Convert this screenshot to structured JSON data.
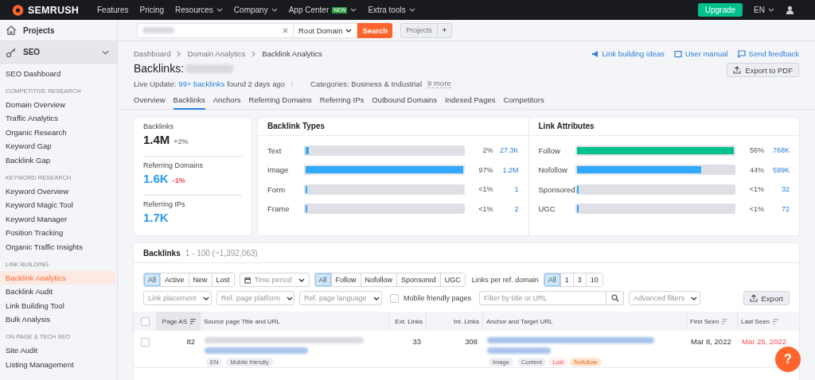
{
  "topnav": {
    "logo": "SEMRUSH",
    "items": [
      {
        "label": "Features",
        "dropdown": false
      },
      {
        "label": "Pricing",
        "dropdown": false
      },
      {
        "label": "Resources",
        "dropdown": true
      },
      {
        "label": "Company",
        "dropdown": true
      },
      {
        "label": "App Center",
        "dropdown": true,
        "badge": "NEW"
      },
      {
        "label": "Extra tools",
        "dropdown": true
      }
    ],
    "upgrade": "Upgrade",
    "language": "EN"
  },
  "sidebar": {
    "projects": "Projects",
    "seo": {
      "label": "SEO",
      "expanded": true
    },
    "sections": [
      {
        "items": [
          {
            "label": "SEO Dashboard",
            "selected": false
          }
        ]
      },
      {
        "heading": "COMPETITIVE RESEARCH",
        "items": [
          {
            "label": "Domain Overview",
            "selected": false
          },
          {
            "label": "Traffic Analytics",
            "selected": false
          },
          {
            "label": "Organic Research",
            "selected": false
          },
          {
            "label": "Keyword Gap",
            "selected": false
          },
          {
            "label": "Backlink Gap",
            "selected": false
          }
        ]
      },
      {
        "heading": "KEYWORD RESEARCH",
        "items": [
          {
            "label": "Keyword Overview",
            "selected": false
          },
          {
            "label": "Keyword Magic Tool",
            "selected": false
          },
          {
            "label": "Keyword Manager",
            "selected": false
          },
          {
            "label": "Position Tracking",
            "selected": false
          },
          {
            "label": "Organic Traffic Insights",
            "selected": false
          }
        ]
      },
      {
        "heading": "LINK BUILDING",
        "items": [
          {
            "label": "Backlink Analytics",
            "selected": true
          },
          {
            "label": "Backlink Audit",
            "selected": false
          },
          {
            "label": "Link Building Tool",
            "selected": false
          },
          {
            "label": "Bulk Analysis",
            "selected": false
          }
        ]
      },
      {
        "heading": "ON PAGE & TECH SEO",
        "items": [
          {
            "label": "Site Audit",
            "selected": false
          },
          {
            "label": "Listing Management",
            "selected": false
          }
        ]
      }
    ]
  },
  "searchbar": {
    "scope": "Root Domain",
    "button": "Search",
    "projects": "Projects",
    "add": "+"
  },
  "breadcrumbs": [
    "Dashboard",
    "Domain Analytics",
    "Backlink Analytics"
  ],
  "title": "Backlinks:",
  "live_update": {
    "label": "Live Update:",
    "link": "99+ backlinks",
    "suffix": "found 2 days ago",
    "categories": "Categories: Business & Industrial",
    "more": "9 more"
  },
  "header_links": [
    "Link building ideas",
    "User manual",
    "Send feedback"
  ],
  "export_pdf": "Export to PDF",
  "tabs": [
    {
      "label": "Overview",
      "selected": false
    },
    {
      "label": "Backlinks",
      "selected": true
    },
    {
      "label": "Anchors",
      "selected": false
    },
    {
      "label": "Referring Domains",
      "selected": false
    },
    {
      "label": "Referring IPs",
      "selected": false
    },
    {
      "label": "Outbound Domains",
      "selected": false
    },
    {
      "label": "Indexed Pages",
      "selected": false
    },
    {
      "label": "Competitors",
      "selected": false
    }
  ],
  "metrics": [
    {
      "label": "Backlinks",
      "value": "1.4M",
      "kind": "plain",
      "change": "+2%",
      "color": "#8a8a8a"
    },
    {
      "label": "Referring Domains",
      "value": "1.6K",
      "kind": "link",
      "change": "-1%",
      "color": "#ff4953"
    },
    {
      "label": "Referring IPs",
      "value": "1.7K",
      "kind": "link"
    }
  ],
  "bar_panels": [
    {
      "title": "Backlink Types",
      "rows": [
        {
          "label": "Text",
          "level": 0.02,
          "color": "#2fa8ff",
          "percent": "2%",
          "count": "27.3K"
        },
        {
          "label": "Image",
          "level": 1,
          "color": "#2fa8ff",
          "percent": "97%",
          "count": "1.2M"
        },
        {
          "label": "Form",
          "level": 0.005,
          "color": "#2fa8ff",
          "percent": "<1%",
          "count": "1"
        },
        {
          "label": "Frame",
          "level": 0.005,
          "color": "#2fa8ff",
          "percent": "<1%",
          "count": "2"
        }
      ]
    },
    {
      "title": "Link Attributes",
      "rows": [
        {
          "label": "Follow",
          "level": 1,
          "color": "#00c08b",
          "percent": "56%",
          "count": "768K"
        },
        {
          "label": "Nofollow",
          "level": 0.79,
          "color": "#2fa8ff",
          "percent": "44%",
          "count": "599K"
        },
        {
          "label": "Sponsored",
          "level": 0.005,
          "color": "#2fa8ff",
          "percent": "<1%",
          "count": "32"
        },
        {
          "label": "UGC",
          "level": 0.005,
          "color": "#2fa8ff",
          "percent": "<1%",
          "count": "72"
        }
      ]
    }
  ],
  "backlinks": {
    "title": "Backlinks",
    "range": "1 - 100 (~1,392,063)",
    "status_filter": [
      {
        "label": "All",
        "selected": true
      },
      {
        "label": "Active",
        "selected": false
      },
      {
        "label": "New",
        "selected": false
      },
      {
        "label": "Lost",
        "selected": false
      }
    ],
    "time_period": "Time period",
    "type_filter": [
      {
        "label": "All",
        "selected": true
      },
      {
        "label": "Follow",
        "selected": false
      },
      {
        "label": "Nofollow",
        "selected": false
      },
      {
        "label": "Sponsored",
        "selected": false
      },
      {
        "label": "UGC",
        "selected": false
      }
    ],
    "per_domain_label": "Links per ref. domain",
    "per_domain": [
      {
        "label": "All",
        "selected": true
      },
      {
        "label": "1",
        "selected": false
      },
      {
        "label": "3",
        "selected": false
      },
      {
        "label": "10",
        "selected": false
      }
    ],
    "dropdowns": [
      "Link placement",
      "Ref. page platform",
      "Ref. page language"
    ],
    "select_all_checked": false,
    "mobile_checkbox": {
      "label": "Mobile friendly pages",
      "checked": false
    },
    "filter_placeholder": "Filter by title or URL",
    "advanced": "Advanced filters",
    "export": "Export",
    "columns": [
      {
        "label": "Page AS",
        "sortable": true,
        "sorted": true
      },
      {
        "label": "Source page Title and URL",
        "sortable": false,
        "sorted": false
      },
      {
        "label": "Ext. Links",
        "sortable": false,
        "sorted": false
      },
      {
        "label": "Int. Links",
        "sortable": false,
        "sorted": false
      },
      {
        "label": "Anchor and Target URL",
        "sortable": false,
        "sorted": false
      },
      {
        "label": "First Seen",
        "sortable": true,
        "sorted": false
      },
      {
        "label": "Last Seen",
        "sortable": true,
        "sorted": false
      }
    ],
    "rows": [
      {
        "checked": false,
        "page_as": "82",
        "source_tags": [
          {
            "label": "EN",
            "kind": "plain"
          },
          {
            "label": "Mobile friendly",
            "kind": "plain"
          }
        ],
        "ext": "33",
        "int": "308",
        "anchor_tags": [
          {
            "label": "Image",
            "kind": "plain"
          },
          {
            "label": "Content",
            "kind": "plain"
          },
          {
            "label": "Lost",
            "kind": "lost"
          },
          {
            "label": "Nofollow",
            "kind": "nofollow"
          }
        ],
        "first_seen": "Mar 8, 2022",
        "last_seen": "Mar 25, 2022",
        "lost": true
      }
    ]
  },
  "help": "?"
}
